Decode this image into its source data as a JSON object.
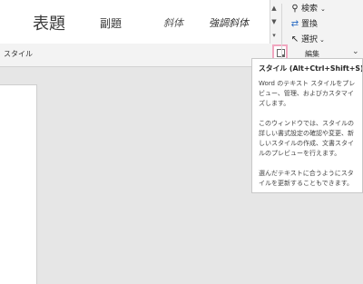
{
  "style_gallery": {
    "items": [
      {
        "label": "表題"
      },
      {
        "label": "副題"
      },
      {
        "label": "斜体"
      },
      {
        "label": "強調斜体"
      }
    ],
    "group_label": "スタイル"
  },
  "editing": {
    "find_label": "検索",
    "replace_label": "置換",
    "select_label": "選択",
    "group_label": "編集"
  },
  "tooltip": {
    "title": "スタイル (Alt+Ctrl+Shift+S)",
    "paragraphs": [
      "Word のテキスト スタイルをプレビュー、管理、およびカスタマイズします。",
      "このウィンドウでは、スタイルの詳しい書式設定の確認や変更、新しいスタイルの作成、文書スタイルのプレビューを行えます。",
      "選んだテキストに合うようにスタイルを更新することもできます。"
    ]
  },
  "icons": {
    "find": "search-icon",
    "replace": "replace-icon",
    "select": "select-cursor-icon",
    "launcher": "dialog-launcher-icon"
  },
  "colors": {
    "highlight_border": "#f1a7c0",
    "ribbon_bg": "#f3f3f3",
    "doc_bg": "#e6e6e6"
  }
}
